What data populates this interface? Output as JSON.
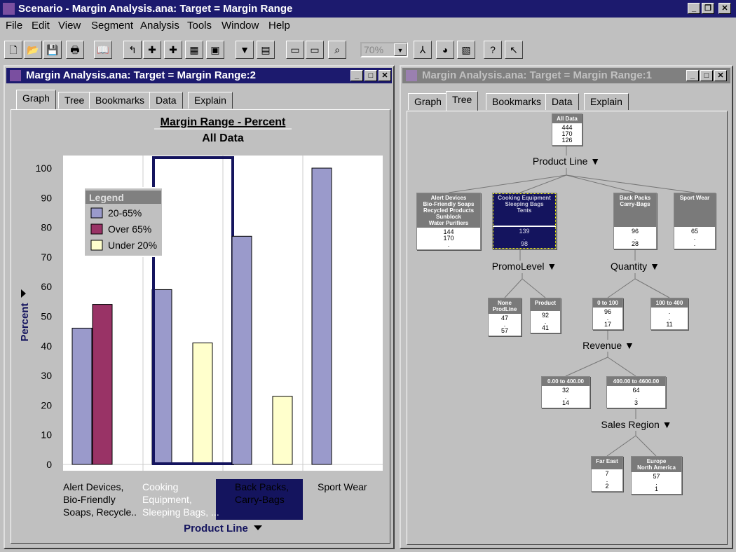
{
  "app": {
    "title": "Scenario - Margin Analysis.ana:  Target = Margin Range"
  },
  "menu": [
    "File",
    "Edit",
    "View",
    "Segment",
    "Analysis",
    "Tools",
    "Window",
    "Help"
  ],
  "toolbar": {
    "zoom_value": "70%",
    "icons": [
      "new-icon",
      "open-icon",
      "save-icon",
      "print-icon",
      "book-icon",
      "back-icon",
      "expand-icon",
      "add-icon",
      "grid-icon",
      "split-icon",
      "filter-icon",
      "report-icon",
      "prev-icon",
      "next-icon",
      "find-icon",
      "run-icon",
      "pie-icon",
      "cube-icon",
      "help-icon",
      "context-help-icon"
    ]
  },
  "left_window": {
    "title": "Margin Analysis.ana:  Target = Margin Range:2",
    "tabs": [
      "Graph",
      "Tree",
      "Bookmarks",
      "Data",
      "Explain"
    ],
    "active_tab": "Graph"
  },
  "right_window": {
    "title": "Margin Analysis.ana:  Target = Margin Range:1",
    "tabs": [
      "Graph",
      "Tree",
      "Bookmarks",
      "Data",
      "Explain"
    ],
    "active_tab": "Tree"
  },
  "chart_data": {
    "type": "bar",
    "title": "Margin Range - Percent",
    "subtitle": "All Data",
    "xlabel": "Product Line",
    "ylabel": "Percent",
    "ylim": [
      0,
      100
    ],
    "yticks": [
      "0",
      "10",
      "20",
      "30",
      "40",
      "50",
      "60",
      "70",
      "80",
      "90",
      "100"
    ],
    "categories": [
      "Alert Devices, Bio-Friendly Soaps, Recycle..",
      "Cooking Equipment, Sleeping Bags, ...",
      "Back Packs, Carry-Bags",
      "Sport Wear"
    ],
    "selected_category": 1,
    "legend": {
      "title": "Legend",
      "placement": "top-left"
    },
    "series": [
      {
        "name": "20-65%",
        "color": "#9a9acb",
        "values": [
          46,
          59,
          77,
          100
        ]
      },
      {
        "name": "Over 65%",
        "color": "#993366",
        "values": [
          54,
          0,
          0,
          0
        ]
      },
      {
        "name": "Under 20%",
        "color": "#ffffcc",
        "values": [
          0,
          41,
          23,
          0
        ]
      }
    ]
  },
  "tree": {
    "root": {
      "label": "All Data",
      "values": [
        "444",
        "170",
        "126"
      ]
    },
    "splits": {
      "product_line": "Product Line",
      "promo": "PromoLevel",
      "quantity": "Quantity",
      "revenue": "Revenue",
      "region": "Sales Region"
    },
    "nodes": {
      "alert": {
        "label": "Alert Devices\nBio-Friendly Soaps\nRecycled Products\nSunblock\nWater Purifiers",
        "values": [
          "144",
          "170",
          "."
        ]
      },
      "cooking": {
        "label": "Cooking Equipment\nSleeping Bags\nTents",
        "values": [
          "139",
          ".",
          "98"
        ]
      },
      "backpacks": {
        "label": "Back Packs\nCarry-Bags",
        "values": [
          "96",
          ".",
          "28"
        ]
      },
      "sportwear": {
        "label": "Sport Wear",
        "values": [
          "65",
          ".",
          "."
        ]
      },
      "none": {
        "label": "None\nProdLine",
        "values": [
          "47",
          ".",
          "57"
        ]
      },
      "product": {
        "label": "Product",
        "values": [
          "92",
          ".",
          "41"
        ]
      },
      "q0": {
        "label": "0 to 100",
        "values": [
          "96",
          ".",
          "17"
        ]
      },
      "q100": {
        "label": "100 to 400",
        "values": [
          ".",
          ".",
          "11"
        ]
      },
      "r0": {
        "label": "0.00 to 400.00",
        "values": [
          "32",
          ".",
          "14"
        ]
      },
      "r400": {
        "label": "400.00 to 4600.00",
        "values": [
          "64",
          ".",
          "3"
        ]
      },
      "fareast": {
        "label": "Far East",
        "values": [
          "7",
          ".",
          "2"
        ]
      },
      "europe": {
        "label": "Europe\nNorth America",
        "values": [
          "57",
          ".",
          "1"
        ]
      }
    }
  }
}
